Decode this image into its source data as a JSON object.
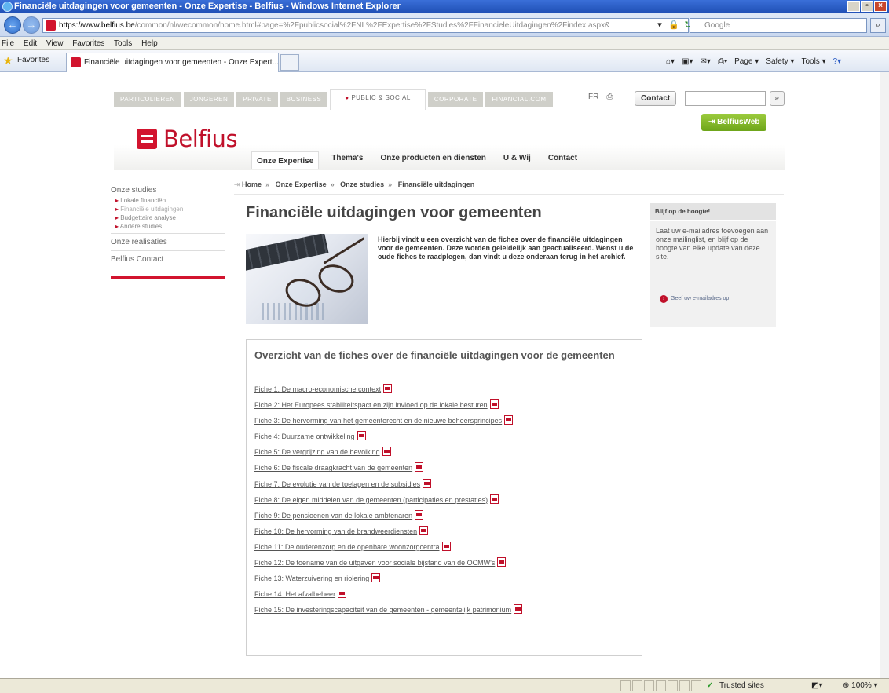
{
  "browser": {
    "title": "Financiële uitdagingen voor gemeenten - Onze Expertise - Belfius - Windows Internet Explorer",
    "url_host": "https://www.belfius.be",
    "url_rest": "/common/nl/wecommon/home.html#page=%2Fpublicsocial%2FNL%2FExpertise%2FStudies%2FFinancieleUitdagingen%2Findex.aspx&",
    "search_placeholder": "Google",
    "menu": [
      "File",
      "Edit",
      "View",
      "Favorites",
      "Tools",
      "Help"
    ],
    "favorites_label": "Favorites",
    "tab_title": "Financiële uitdagingen voor gemeenten - Onze Expert...",
    "commands": [
      "Page ▾",
      "Safety ▾",
      "Tools ▾"
    ],
    "status_trusted": "Trusted sites",
    "zoom": "100%"
  },
  "site": {
    "topnav": [
      "PARTICULIEREN",
      "JONGEREN",
      "PRIVATE",
      "BUSINESS",
      "PUBLIC & SOCIAL",
      "CORPORATE",
      "FINANCIAL.COM"
    ],
    "lang": "FR",
    "contact_label": "Contact",
    "logo_text": "Belfius",
    "belfiusweb_label": "BelfiusWeb",
    "mainnav": [
      "Onze Expertise",
      "Thema's",
      "Onze producten en diensten",
      "U & Wij",
      "Contact"
    ],
    "breadcrumb": [
      "Home",
      "Onze Expertise",
      "Onze studies",
      "Financiële uitdagingen"
    ]
  },
  "sidebar": {
    "onze_studies": "Onze studies",
    "sub": [
      "Lokale financiën",
      "Financiële uitdagingen",
      "Budgettaire analyse",
      "Andere studies"
    ],
    "onze_realisaties": "Onze realisaties",
    "contact": "Belfius Contact"
  },
  "main": {
    "title": "Financiële uitdagingen voor gemeenten",
    "intro": "Hierbij vindt u een overzicht van de fiches over de financiële uitdagingen voor de gemeenten. Deze worden geleidelijk aan geactualiseerd. Wenst u de oude fiches te raadplegen, dan vindt u deze onderaan terug in het archief.",
    "list_heading": "Overzicht van de fiches over de financiële uitdagingen voor de gemeenten",
    "fiches": [
      "Fiche 1: De macro-economische context",
      "Fiche 2: Het Europees stabiliteitspact en zijn invloed op de lokale besturen",
      "Fiche 3: De hervorming van het gemeenterecht en de nieuwe beheersprincipes",
      "Fiche 4: Duurzame ontwikkeling",
      "Fiche 5: De vergrijzing van de bevolking",
      "Fiche 6: De fiscale draagkracht van de gemeenten",
      "Fiche 7: De evolutie van de toelagen en de subsidies",
      "Fiche 8: De eigen middelen van de gemeenten (participaties en prestaties)",
      "Fiche 9: De pensioenen van de lokale ambtenaren",
      "Fiche 10: De hervorming van de brandweerdiensten",
      "Fiche 11: De ouderenzorg en de openbare woonzorgcentra",
      "Fiche 12: De toename van de uitgaven voor sociale bijstand van de OCMW's",
      "Fiche 13: Waterzuivering en riolering",
      "Fiche 14: Het afvalbeheer",
      "Fiche 15: De investeringscapaciteit van de gemeenten - gemeentelijk patrimonium"
    ]
  },
  "rightbox": {
    "heading": "Blijf op de hoogte!",
    "text": "Laat uw e-mailadres toevoegen aan onze mailinglist, en blijf op de hoogte van elke update van deze site.",
    "link": "Geef uw e-mailadres op"
  }
}
